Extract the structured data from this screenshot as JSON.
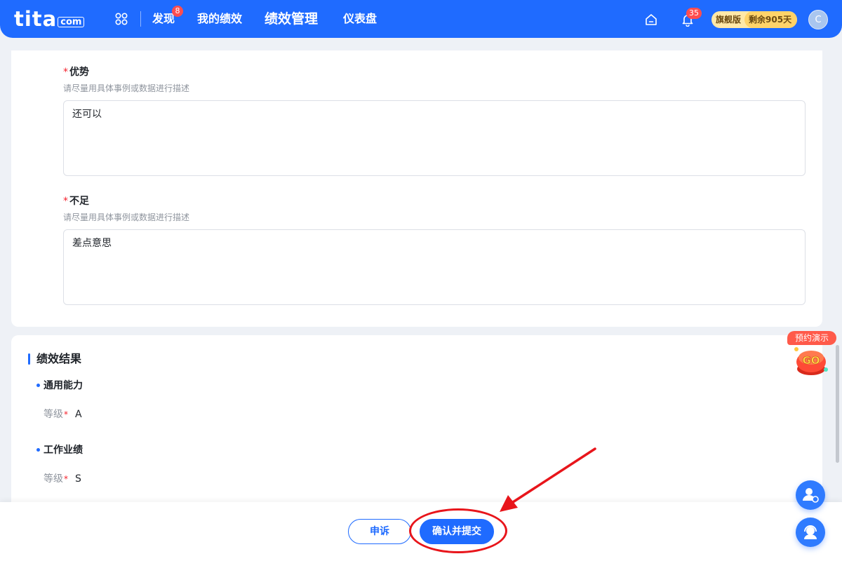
{
  "brand": {
    "logo_main": "tita",
    "logo_suffix": "com",
    "accent": "#1f6bff"
  },
  "nav": {
    "items": [
      {
        "label": "发现",
        "badge": "8"
      },
      {
        "label": "我的绩效"
      },
      {
        "label": "绩效管理",
        "active": true
      },
      {
        "label": "仪表盘"
      }
    ],
    "notification_count": "35",
    "plan_name": "旗舰版",
    "plan_remaining": "剩余905天",
    "avatar_initial": "C"
  },
  "form": {
    "strengths": {
      "label": "优势",
      "required_mark": "*",
      "hint": "请尽量用具体事例或数据进行描述",
      "value": "还可以"
    },
    "weaknesses": {
      "label": "不足",
      "required_mark": "*",
      "hint": "请尽量用具体事例或数据进行描述",
      "value": "差点意思"
    }
  },
  "result": {
    "title": "绩效结果",
    "groups": [
      {
        "title": "通用能力",
        "grade_label": "等级",
        "required_mark": "*",
        "grade": "A"
      },
      {
        "title": "工作业绩",
        "grade_label": "等级",
        "required_mark": "*",
        "grade": "S"
      }
    ]
  },
  "actions": {
    "appeal_label": "申诉",
    "confirm_label": "确认并提交"
  },
  "widgets": {
    "demo_tag": "预约演示",
    "demo_go": "GO"
  },
  "icons": [
    "apps-icon",
    "home-icon",
    "bell-icon",
    "go-icon",
    "user-settings-icon",
    "support-icon"
  ],
  "annotation_color": "#e8151b"
}
